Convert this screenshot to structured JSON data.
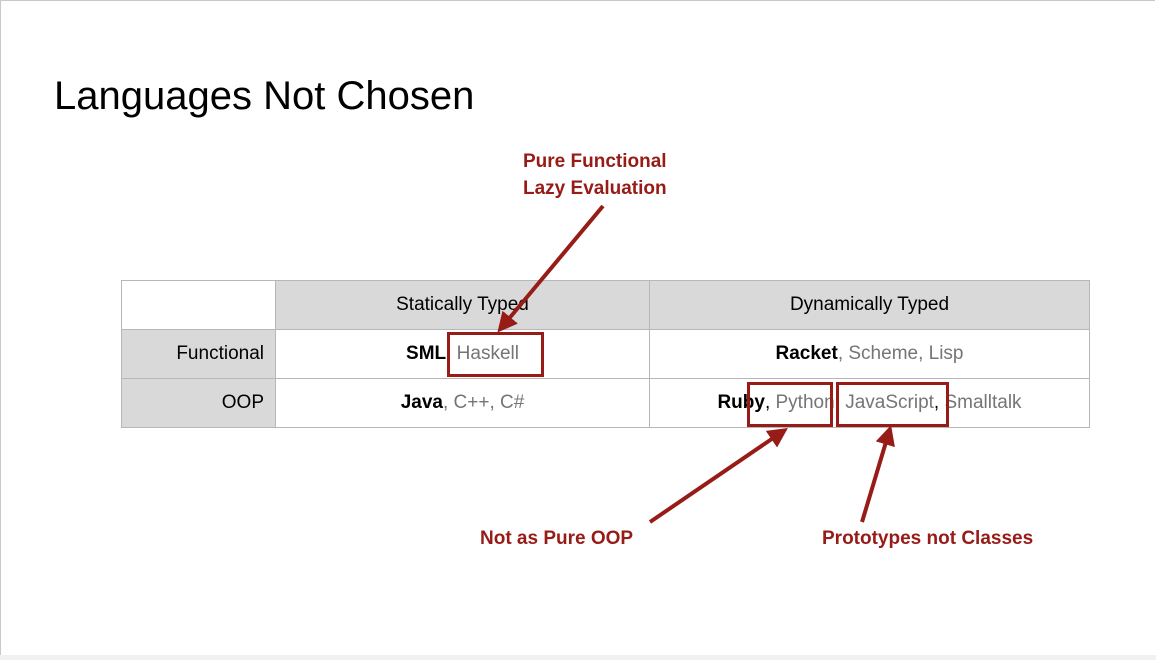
{
  "slide": {
    "title": "Languages Not Chosen"
  },
  "table": {
    "header": {
      "static": "Statically Typed",
      "dynamic": "Dynamically Typed"
    },
    "rows": [
      {
        "label": "Functional",
        "static": {
          "main": "SML",
          "sep": ",",
          "rest": " Haskell"
        },
        "dynamic": {
          "main": "Racket",
          "rest": ", Scheme, Lisp"
        }
      },
      {
        "label": "OOP",
        "static": {
          "main": "Java",
          "rest": ", C++, C#"
        },
        "dynamic": {
          "main": "Ruby",
          "sep1": ",",
          "python": " Python",
          "sep2": ",",
          "js": " JavaScript",
          "sep3": ",",
          "rest": " Smalltalk"
        }
      }
    ]
  },
  "annotations": {
    "haskell_line1": "Pure Functional",
    "haskell_line2": "Lazy Evaluation",
    "python": "Not as Pure OOP",
    "javascript": "Prototypes not Classes"
  },
  "colors": {
    "accent": "#971b17",
    "header_fill": "#d9d9d9",
    "muted_text": "#757575",
    "grid_line": "#b7b7b7"
  }
}
